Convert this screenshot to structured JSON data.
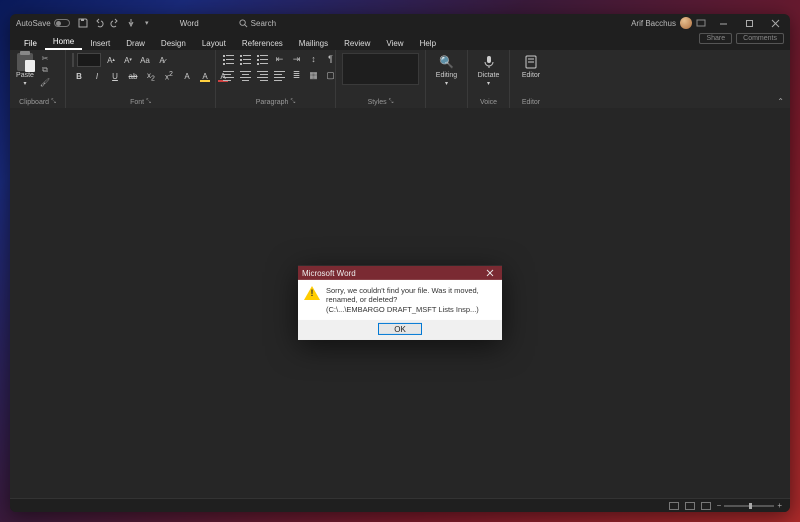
{
  "titlebar": {
    "autosave": "AutoSave",
    "doc": "Word",
    "search": "Search",
    "user": "Arif Bacchus"
  },
  "tabs": {
    "file": "File",
    "home": "Home",
    "insert": "Insert",
    "draw": "Draw",
    "design": "Design",
    "layout": "Layout",
    "references": "References",
    "mailings": "Mailings",
    "review": "Review",
    "view": "View",
    "help": "Help"
  },
  "tabs_right": {
    "share": "Share",
    "comments": "Comments"
  },
  "ribbon": {
    "clipboard": {
      "label": "Clipboard",
      "paste": "Paste"
    },
    "font": {
      "label": "Font",
      "aplus": "A",
      "aminus": "A",
      "aa": "Aa",
      "b": "B",
      "i": "I",
      "u": "U",
      "ab": "ab",
      "x1": "x",
      "x2": "x",
      "a_fx": "A",
      "a_hl": "A",
      "a_color": "A"
    },
    "paragraph": {
      "label": "Paragraph"
    },
    "styles": {
      "label": "Styles"
    },
    "editing": {
      "label": "Editing"
    },
    "voice": {
      "label": "Voice",
      "dictate": "Dictate"
    },
    "editor": {
      "label": "Editor",
      "btn": "Editor"
    }
  },
  "dialog": {
    "title": "Microsoft Word",
    "msg1": "Sorry, we couldn't find your file. Was it moved, renamed, or deleted?",
    "msg2": "(C:\\...\\EMBARGO DRAFT_MSFT Lists Insp...)",
    "ok": "OK"
  },
  "status": {
    "zoom_minus": "−",
    "zoom_plus": "+"
  }
}
